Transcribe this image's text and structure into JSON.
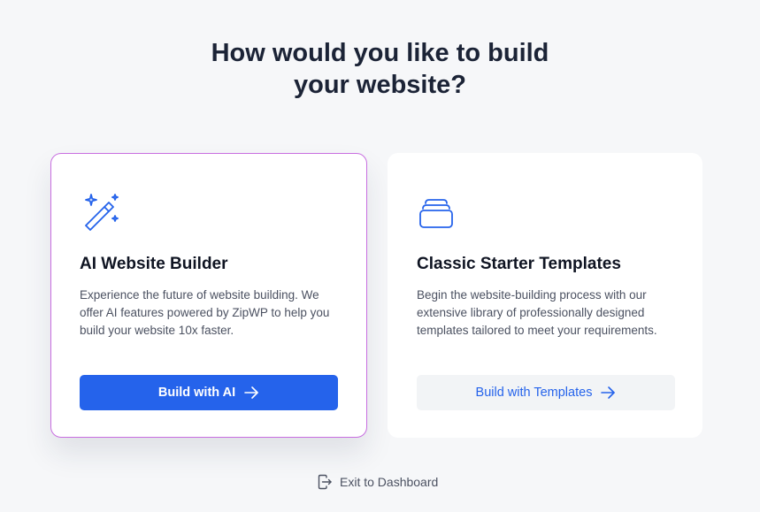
{
  "heading": {
    "line1": "How would you like to build",
    "line2": "your website?"
  },
  "cards": [
    {
      "title": "AI Website Builder",
      "description": "Experience the future of website building. We offer AI features powered by ZipWP to help you build your website 10x faster.",
      "button_label": "Build with AI",
      "icon": "magic-wand-icon",
      "selected": true
    },
    {
      "title": "Classic Starter Templates",
      "description": "Begin the website-building process with our extensive library of professionally designed templates tailored to meet your requirements.",
      "button_label": "Build with Templates",
      "icon": "template-stack-icon",
      "selected": false
    }
  ],
  "footer": {
    "exit_label": "Exit to Dashboard",
    "icon": "exit-door-icon"
  },
  "colors": {
    "primary": "#2563eb",
    "selected_border": "#c86ee0",
    "heading": "#1b2336",
    "background": "#f6f7f9"
  }
}
